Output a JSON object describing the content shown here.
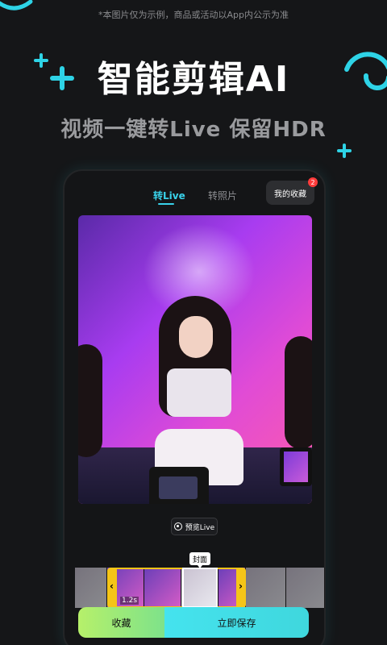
{
  "disclaimer": "*本图片仅为示例，商品或活动以App内公示为准",
  "headline": "智能剪辑AI",
  "subhead": "视频一键转Live  保留HDR",
  "tabs": [
    {
      "label": "转Live",
      "active": true
    },
    {
      "label": "转照片",
      "active": false
    }
  ],
  "favorites_button": {
    "label": "我的收藏",
    "badge": "2"
  },
  "preview_button": {
    "label": "预览Live",
    "icon": "live-photo-icon"
  },
  "cover_tag": "封面",
  "timeline": {
    "duration": "1.2s",
    "left_handle": "‹",
    "right_handle": "›"
  },
  "actions": {
    "collect_label": "收藏",
    "save_label": "立即保存"
  },
  "colors": {
    "accent": "#39d2ea",
    "save_gradient": "#45e3ee",
    "collect_gradient": "#b6f06a",
    "handle": "#f5c518"
  }
}
